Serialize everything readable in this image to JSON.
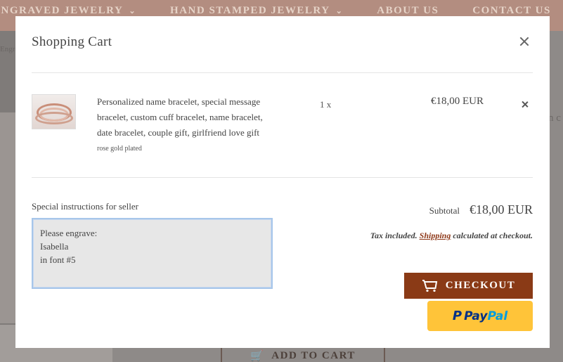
{
  "background_page": {
    "nav_items": [
      "Engraved Jewelry",
      "Hand Stamped Jewelry",
      "About Us",
      "Contact Us"
    ],
    "breadcrumb": "Engra",
    "right_fragment": "n c",
    "add_to_cart_label": "Add to cart"
  },
  "cart": {
    "title": "Shopping Cart",
    "item": {
      "title": "Personalized name bracelet, special message bracelet, custom cuff bracelet, name bracelet, date bracelet, couple gift, girlfriend love gift",
      "variant": "rose gold plated",
      "quantity": "1 x",
      "price": "€18,00 EUR"
    },
    "note": {
      "label": "Special instructions for seller",
      "lines": [
        "Please engrave:",
        "Isabella",
        "in font #5"
      ]
    },
    "subtotal": {
      "label": "Subtotal",
      "value": "€18,00 EUR"
    },
    "tax_note": {
      "prefix": "Tax included.",
      "link": "Shipping",
      "suffix": "calculated at checkout."
    },
    "checkout_label": "Checkout",
    "paypal": {
      "pay": "Pay",
      "pal": "Pal"
    }
  },
  "colors": {
    "checkout_bg": "#8a3a16",
    "paypal_bg": "#ffc439",
    "link": "#8f3a1a"
  },
  "icons": [
    "close-icon",
    "remove-icon",
    "cart-icon",
    "paypal-logo-icon",
    "chevron-down-icon"
  ]
}
